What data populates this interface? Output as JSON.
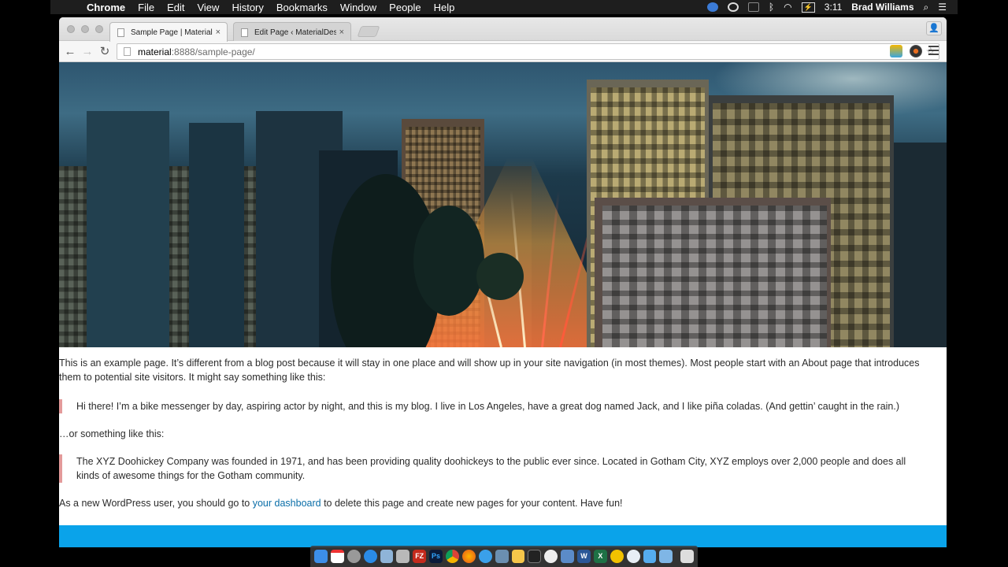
{
  "menubar": {
    "apple_glyph": "",
    "app_name": "Chrome",
    "items": [
      "File",
      "Edit",
      "View",
      "History",
      "Bookmarks",
      "Window",
      "People",
      "Help"
    ],
    "battery_glyph": "⚡",
    "clock": "3:11",
    "user": "Brad Williams"
  },
  "browser": {
    "tabs": [
      {
        "title": "Sample Page | MaterialDesign",
        "active": true
      },
      {
        "title": "Edit Page ‹ MaterialDesign",
        "active": false
      }
    ],
    "close_glyph": "×",
    "url_host": "material",
    "url_path": ":8888/sample-page/",
    "bookmark_star": "☆",
    "back_glyph": "←",
    "forward_glyph": "→",
    "reload_glyph": "↻"
  },
  "page": {
    "intro": "This is an example page. It’s different from a blog post because it will stay in one place and will show up in your site navigation (in most themes). Most people start with an About page that introduces them to potential site visitors. It might say something like this:",
    "quote1": "Hi there! I’m a bike messenger by day, aspiring actor by night, and this is my blog. I live in Los Angeles, have a great dog named Jack, and I like piña coladas. (And gettin’ caught in the rain.)",
    "or_text": "…or something like this:",
    "quote2": "The XYZ Doohickey Company was founded in 1971, and has been providing quality doohickeys to the public ever since. Located in Gotham City, XYZ employs over 2,000 people and does all kinds of awesome things for the Gotham community.",
    "closing_before": "As a new WordPress user, you should go to ",
    "closing_link": "your dashboard",
    "closing_after": " to delete this page and create new pages for your content. Have fun!"
  },
  "colors": {
    "footer_bar": "#0aa3ea",
    "quote_border": "#e39a9a",
    "link": "#0a6ea8"
  },
  "dock": {
    "icons": [
      "finder-icon",
      "calendar-icon",
      "launchpad-icon",
      "app-store-icon",
      "preview-icon",
      "archive-icon",
      "filezilla-icon",
      "photoshop-icon",
      "chrome-icon",
      "firefox-icon",
      "safari-icon",
      "image-viewer-icon",
      "sketch-icon",
      "terminal-icon",
      "github-icon",
      "mail-icon",
      "word-icon",
      "excel-icon",
      "notes-icon",
      "skype-icon",
      "twitter-icon",
      "folder-icon",
      "trash-icon"
    ],
    "labels": {
      "filezilla": "FZ",
      "photoshop": "Ps",
      "word": "W",
      "excel": "X"
    }
  }
}
